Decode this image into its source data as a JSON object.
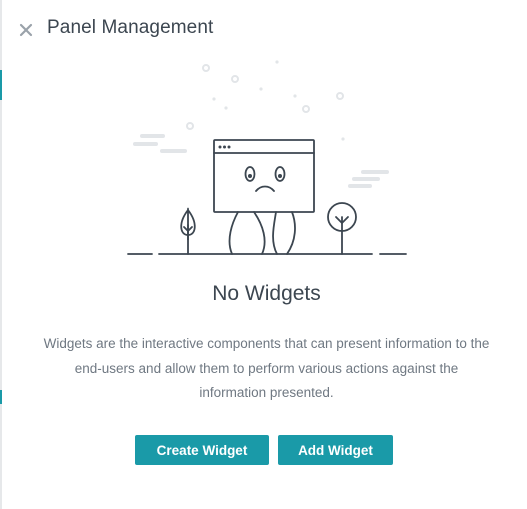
{
  "panel": {
    "title": "Panel Management",
    "close_icon": "close-icon"
  },
  "empty_state": {
    "illustration": "sad-window-illustration",
    "title": "No Widgets",
    "description": "Widgets are the interactive components that can present information to the end-users and allow them to perform various actions against the information presented."
  },
  "actions": {
    "create_label": "Create Widget",
    "add_label": "Add Widget"
  },
  "colors": {
    "accent": "#1a9aa8",
    "text_dark": "#3c4650",
    "text_muted": "#6f7882",
    "illustration_line": "#3c4650",
    "illustration_light": "#e2e5e8"
  }
}
